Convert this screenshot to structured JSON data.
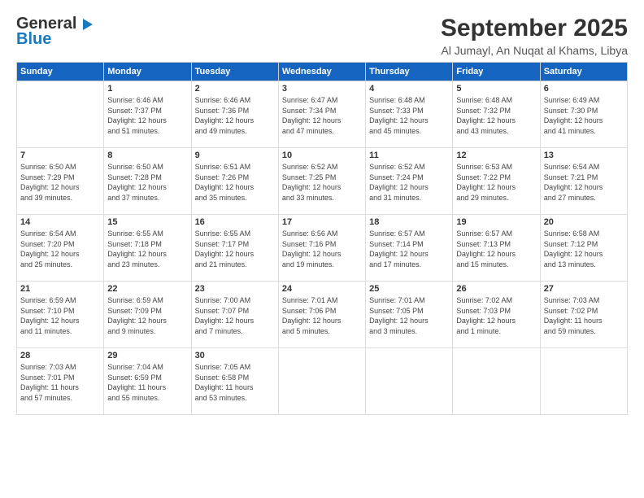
{
  "header": {
    "logo_line1": "General",
    "logo_line2": "Blue",
    "title": "September 2025",
    "location": "Al Jumayl, An Nuqat al Khams, Libya"
  },
  "weekdays": [
    "Sunday",
    "Monday",
    "Tuesday",
    "Wednesday",
    "Thursday",
    "Friday",
    "Saturday"
  ],
  "weeks": [
    [
      {
        "day": "",
        "info": ""
      },
      {
        "day": "1",
        "info": "Sunrise: 6:46 AM\nSunset: 7:37 PM\nDaylight: 12 hours\nand 51 minutes."
      },
      {
        "day": "2",
        "info": "Sunrise: 6:46 AM\nSunset: 7:36 PM\nDaylight: 12 hours\nand 49 minutes."
      },
      {
        "day": "3",
        "info": "Sunrise: 6:47 AM\nSunset: 7:34 PM\nDaylight: 12 hours\nand 47 minutes."
      },
      {
        "day": "4",
        "info": "Sunrise: 6:48 AM\nSunset: 7:33 PM\nDaylight: 12 hours\nand 45 minutes."
      },
      {
        "day": "5",
        "info": "Sunrise: 6:48 AM\nSunset: 7:32 PM\nDaylight: 12 hours\nand 43 minutes."
      },
      {
        "day": "6",
        "info": "Sunrise: 6:49 AM\nSunset: 7:30 PM\nDaylight: 12 hours\nand 41 minutes."
      }
    ],
    [
      {
        "day": "7",
        "info": "Sunrise: 6:50 AM\nSunset: 7:29 PM\nDaylight: 12 hours\nand 39 minutes."
      },
      {
        "day": "8",
        "info": "Sunrise: 6:50 AM\nSunset: 7:28 PM\nDaylight: 12 hours\nand 37 minutes."
      },
      {
        "day": "9",
        "info": "Sunrise: 6:51 AM\nSunset: 7:26 PM\nDaylight: 12 hours\nand 35 minutes."
      },
      {
        "day": "10",
        "info": "Sunrise: 6:52 AM\nSunset: 7:25 PM\nDaylight: 12 hours\nand 33 minutes."
      },
      {
        "day": "11",
        "info": "Sunrise: 6:52 AM\nSunset: 7:24 PM\nDaylight: 12 hours\nand 31 minutes."
      },
      {
        "day": "12",
        "info": "Sunrise: 6:53 AM\nSunset: 7:22 PM\nDaylight: 12 hours\nand 29 minutes."
      },
      {
        "day": "13",
        "info": "Sunrise: 6:54 AM\nSunset: 7:21 PM\nDaylight: 12 hours\nand 27 minutes."
      }
    ],
    [
      {
        "day": "14",
        "info": "Sunrise: 6:54 AM\nSunset: 7:20 PM\nDaylight: 12 hours\nand 25 minutes."
      },
      {
        "day": "15",
        "info": "Sunrise: 6:55 AM\nSunset: 7:18 PM\nDaylight: 12 hours\nand 23 minutes."
      },
      {
        "day": "16",
        "info": "Sunrise: 6:55 AM\nSunset: 7:17 PM\nDaylight: 12 hours\nand 21 minutes."
      },
      {
        "day": "17",
        "info": "Sunrise: 6:56 AM\nSunset: 7:16 PM\nDaylight: 12 hours\nand 19 minutes."
      },
      {
        "day": "18",
        "info": "Sunrise: 6:57 AM\nSunset: 7:14 PM\nDaylight: 12 hours\nand 17 minutes."
      },
      {
        "day": "19",
        "info": "Sunrise: 6:57 AM\nSunset: 7:13 PM\nDaylight: 12 hours\nand 15 minutes."
      },
      {
        "day": "20",
        "info": "Sunrise: 6:58 AM\nSunset: 7:12 PM\nDaylight: 12 hours\nand 13 minutes."
      }
    ],
    [
      {
        "day": "21",
        "info": "Sunrise: 6:59 AM\nSunset: 7:10 PM\nDaylight: 12 hours\nand 11 minutes."
      },
      {
        "day": "22",
        "info": "Sunrise: 6:59 AM\nSunset: 7:09 PM\nDaylight: 12 hours\nand 9 minutes."
      },
      {
        "day": "23",
        "info": "Sunrise: 7:00 AM\nSunset: 7:07 PM\nDaylight: 12 hours\nand 7 minutes."
      },
      {
        "day": "24",
        "info": "Sunrise: 7:01 AM\nSunset: 7:06 PM\nDaylight: 12 hours\nand 5 minutes."
      },
      {
        "day": "25",
        "info": "Sunrise: 7:01 AM\nSunset: 7:05 PM\nDaylight: 12 hours\nand 3 minutes."
      },
      {
        "day": "26",
        "info": "Sunrise: 7:02 AM\nSunset: 7:03 PM\nDaylight: 12 hours\nand 1 minute."
      },
      {
        "day": "27",
        "info": "Sunrise: 7:03 AM\nSunset: 7:02 PM\nDaylight: 11 hours\nand 59 minutes."
      }
    ],
    [
      {
        "day": "28",
        "info": "Sunrise: 7:03 AM\nSunset: 7:01 PM\nDaylight: 11 hours\nand 57 minutes."
      },
      {
        "day": "29",
        "info": "Sunrise: 7:04 AM\nSunset: 6:59 PM\nDaylight: 11 hours\nand 55 minutes."
      },
      {
        "day": "30",
        "info": "Sunrise: 7:05 AM\nSunset: 6:58 PM\nDaylight: 11 hours\nand 53 minutes."
      },
      {
        "day": "",
        "info": ""
      },
      {
        "day": "",
        "info": ""
      },
      {
        "day": "",
        "info": ""
      },
      {
        "day": "",
        "info": ""
      }
    ]
  ]
}
